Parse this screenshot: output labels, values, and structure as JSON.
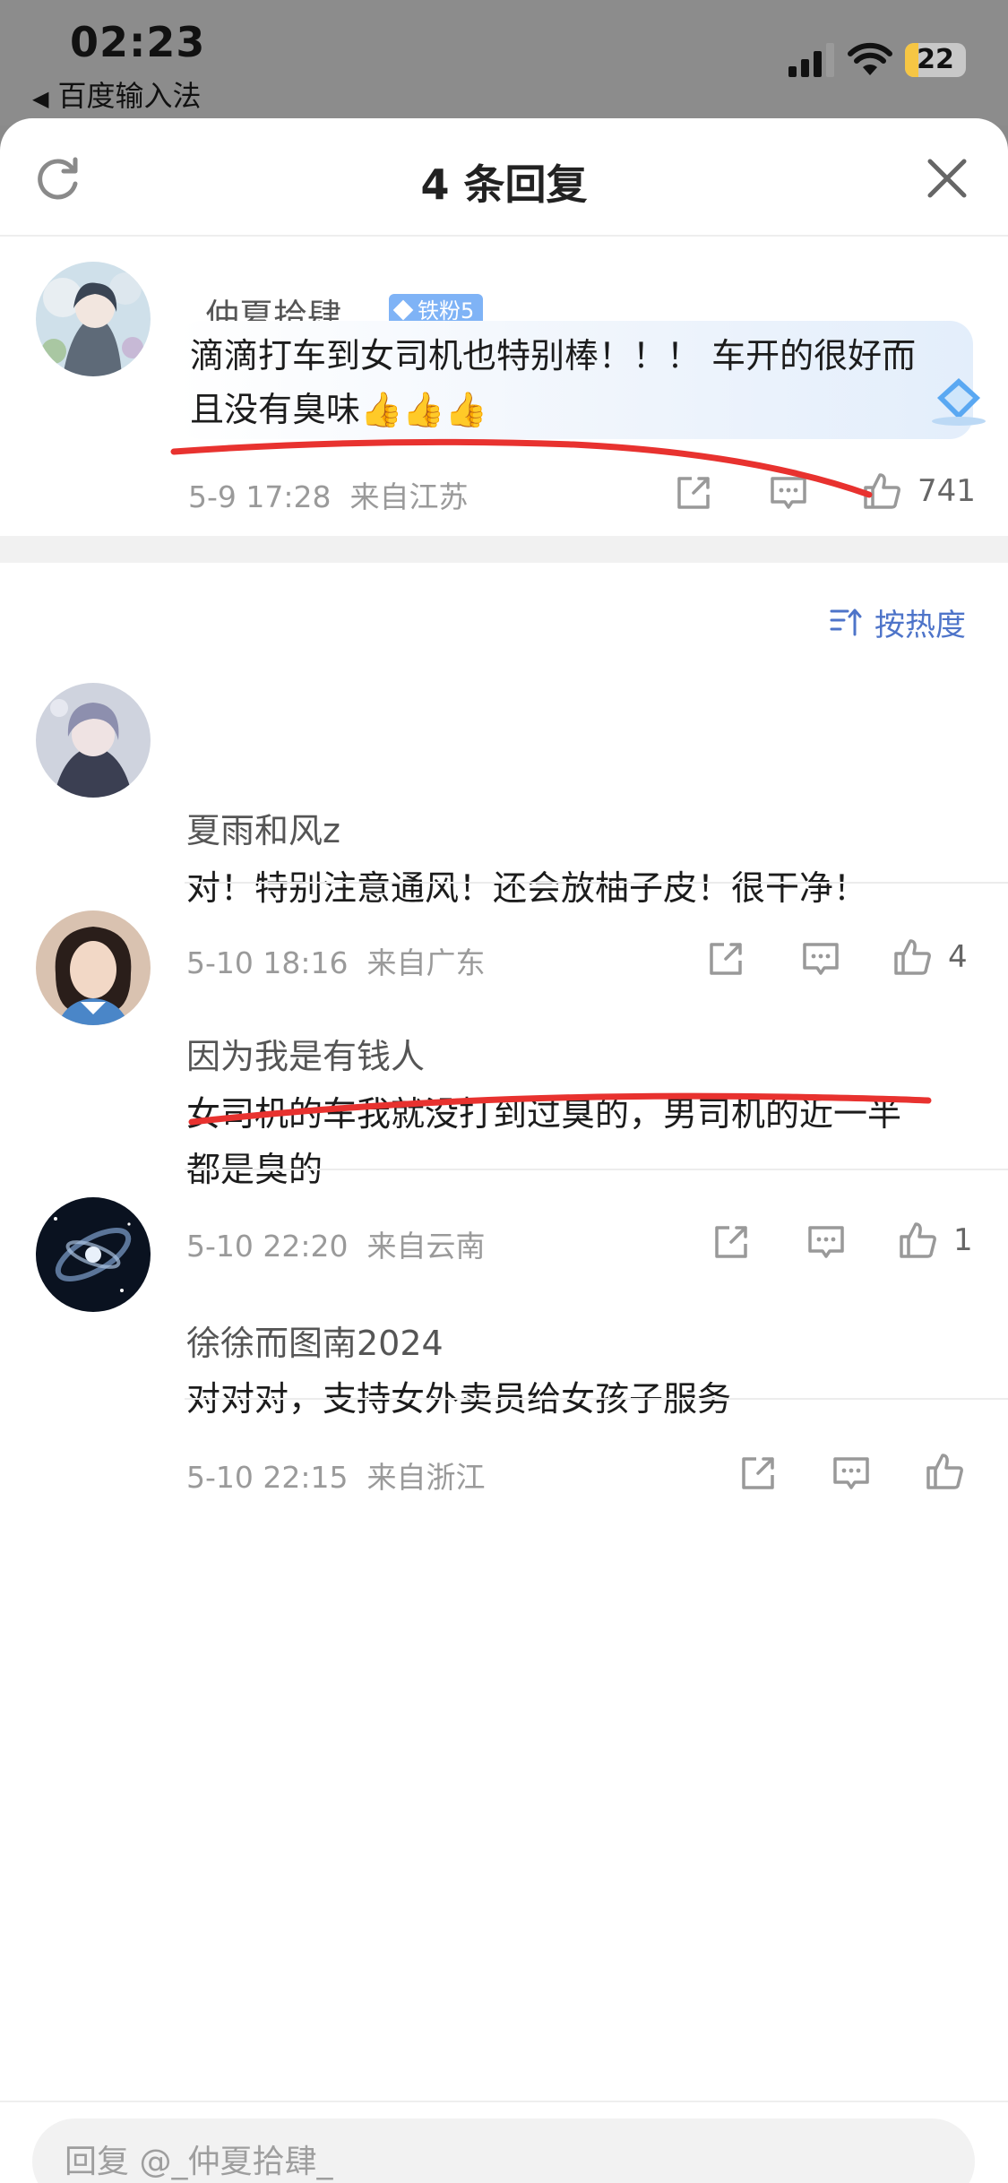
{
  "status": {
    "time": "02:23",
    "back_app": "百度输入法",
    "back_icon": "back-triangle-icon",
    "battery_level": "22",
    "battery_percent": 22
  },
  "header": {
    "title": "4 条回复",
    "refresh_icon": "refresh-icon",
    "close_icon": "close-icon"
  },
  "main_comment": {
    "username": "_仲夏拾肆_",
    "badge": "铁粉5",
    "text_line1": "滴滴打车到女司机也特别棒！！！ 车开的很好而",
    "text_line2": "且没有臭味👍👍👍",
    "time": "5-9 17:28",
    "location": "来自江苏",
    "likes": "741"
  },
  "sort": {
    "label": "按热度",
    "icon": "sort-icon"
  },
  "replies": [
    {
      "username": "夏雨和风z",
      "text_line1": "对！特别注意通风！还会放柚子皮！很干净！",
      "text_line2": "",
      "time": "5-10 18:16",
      "location": "来自广东",
      "likes": "4"
    },
    {
      "username": "因为我是有钱人",
      "text_line1": "女司机的车我就没打到过臭的，男司机的近一半",
      "text_line2": "都是臭的",
      "time": "5-10 22:20",
      "location": "来自云南",
      "likes": "1"
    },
    {
      "username": "徐徐而图南2024",
      "text_line1": "对对对，支持女外卖员给女孩子服务",
      "text_line2": "",
      "time": "5-10 22:15",
      "location": "来自浙江",
      "likes": ""
    }
  ],
  "reply_box": {
    "placeholder": "回复 @_仲夏拾肆_"
  },
  "colors": {
    "accent_blue": "#4e74c9",
    "badge_blue": "#7fb3f6",
    "annotation_red": "#e8322f",
    "meta_gray": "#9a9a9a"
  }
}
